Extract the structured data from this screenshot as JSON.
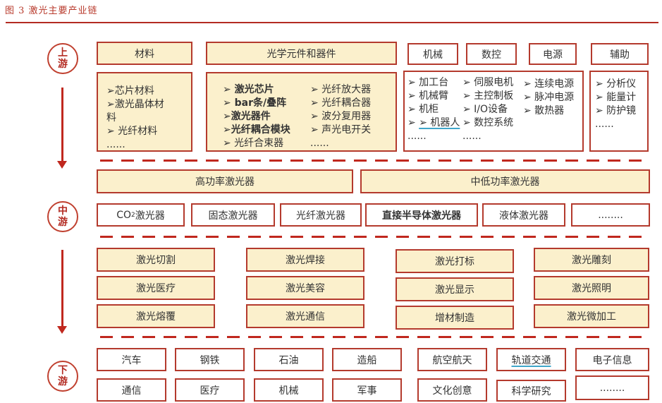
{
  "figure_title": "图 3  激光主要产业链",
  "stages": {
    "upstream": [
      "上",
      "游"
    ],
    "midstream": [
      "中",
      "游"
    ],
    "downstream": [
      "下",
      "游"
    ]
  },
  "upstream": {
    "headers": {
      "materials": "材料",
      "optics": "光学元件和器件",
      "machinery": "机械",
      "cnc": "数控",
      "power": "电源",
      "auxiliary": "辅助"
    },
    "materials_items": [
      "➢芯片材料",
      "➢激光晶体材",
      "料",
      "➢ 光纤材料",
      "......"
    ],
    "optics_col1": [
      "➢ 激光芯片",
      "➢ bar条/叠阵",
      "➢激光器件",
      "➢光纤耦合模块",
      "➢ 光纤合束器"
    ],
    "optics_col2": [
      "➢ 光纤放大器",
      "➢ 光纤耦合器",
      "➢ 波分复用器",
      "➢ 声光电开关",
      "......"
    ],
    "mech_col1": [
      "➢ 加工台",
      "➢ 机械臂",
      "➢ 机柜",
      "➢ 机器人",
      "......"
    ],
    "mech_col2": [
      "➢ 伺服电机",
      "➢ 主控制板",
      "➢ I/O设备",
      "➢ 数控系统",
      "......"
    ],
    "mech_col3": [
      "➢ 连续电源",
      "➢ 脉冲电源",
      "➢ 散热器"
    ],
    "aux_items": [
      "➢ 分析仪",
      "➢ 能量计",
      "➢ 防护镜",
      "......"
    ]
  },
  "midstream": {
    "power_classes": [
      "高功率激光器",
      "中低功率激光器"
    ],
    "laser_types": {
      "co2_prefix": "CO",
      "co2_sub": "2",
      "co2_suffix": "激光器",
      "others": [
        "固态激光器",
        "光纤激光器",
        "直接半导体激光器",
        "液体激光器",
        "........"
      ]
    }
  },
  "downstream": {
    "applications": [
      [
        "激光切割",
        "激光焊接",
        "激光打标",
        "激光雕刻"
      ],
      [
        "激光医疗",
        "激光美容",
        "激光显示",
        "激光照明"
      ],
      [
        "激光熔覆",
        "激光通信",
        "增材制造",
        "激光微加工"
      ]
    ],
    "industries": [
      [
        "汽车",
        "钢铁",
        "石油",
        "造船",
        "航空航天",
        "轨道交通",
        "电子信息"
      ],
      [
        "通信",
        "医疗",
        "机械",
        "军事",
        "文化创意",
        "科学研究",
        "........"
      ]
    ]
  }
}
